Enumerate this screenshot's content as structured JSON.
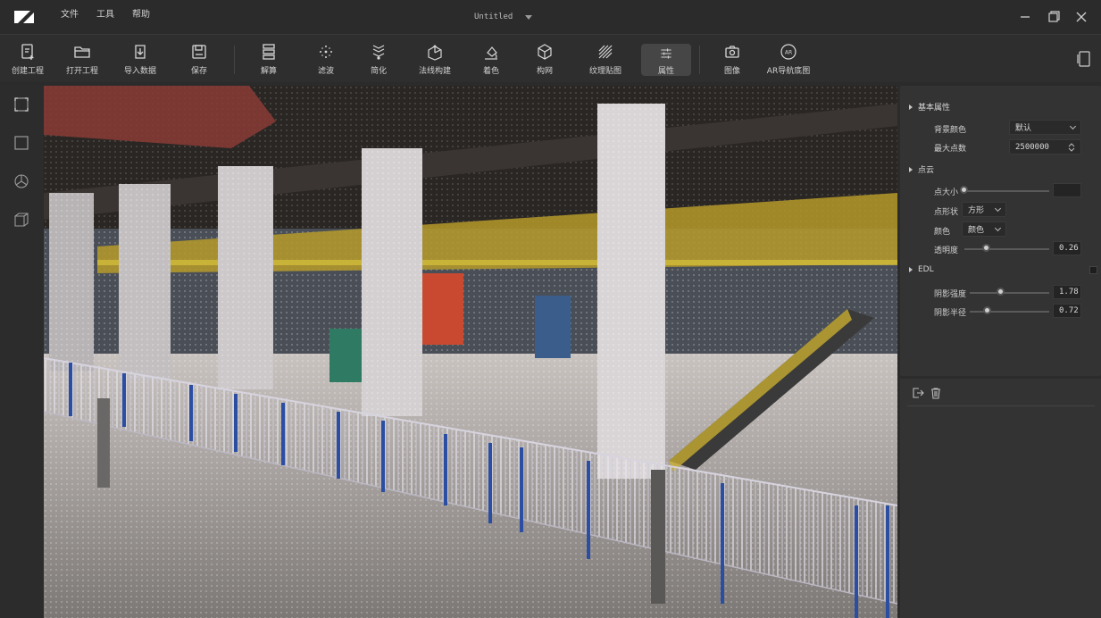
{
  "titlebar": {
    "menu": [
      "文件",
      "工具",
      "帮助"
    ],
    "doc_title": "Untitled"
  },
  "toolbar": {
    "items": [
      {
        "label": "创建工程",
        "icon": "new-project-icon"
      },
      {
        "label": "打开工程",
        "icon": "folder-open-icon"
      },
      {
        "label": "导入数据",
        "icon": "import-icon"
      },
      {
        "label": "保存",
        "icon": "save-icon"
      },
      {
        "label": "解算",
        "icon": "solve-icon"
      },
      {
        "label": "滤波",
        "icon": "filter-icon"
      },
      {
        "label": "简化",
        "icon": "simplify-icon"
      },
      {
        "label": "法线构建",
        "icon": "normal-build-icon"
      },
      {
        "label": "着色",
        "icon": "color-fill-icon"
      },
      {
        "label": "构网",
        "icon": "mesh-icon"
      },
      {
        "label": "纹理贴图",
        "icon": "texture-icon"
      },
      {
        "label": "属性",
        "icon": "properties-icon"
      },
      {
        "label": "图像",
        "icon": "camera-icon"
      },
      {
        "label": "AR导航底图",
        "icon": "ar-map-icon"
      }
    ],
    "active": "属性"
  },
  "panel": {
    "basic": {
      "title": "基本属性",
      "bg_color_label": "背景颜色",
      "bg_color_value": "默认",
      "max_points_label": "最大点数",
      "max_points_value": "2500000"
    },
    "pointcloud": {
      "title": "点云",
      "point_size_label": "点大小",
      "point_size_value": 0.0,
      "point_shape_label": "点形状",
      "point_shape_value": "方形",
      "color_label": "颜色",
      "color_value": "颜色",
      "opacity_label": "透明度",
      "opacity_value": "0.26",
      "opacity_fraction": 0.26
    },
    "edl": {
      "title": "EDL",
      "strength_label": "阴影强度",
      "strength_value": "1.78",
      "strength_fraction": 0.39,
      "radius_label": "阴影半径",
      "radius_value": "0.72",
      "radius_fraction": 0.22
    }
  }
}
